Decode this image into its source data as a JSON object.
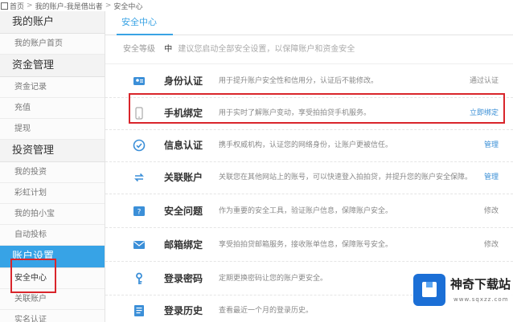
{
  "breadcrumb": {
    "items": [
      "首页",
      "我的账户-我是借出者",
      "安全中心"
    ]
  },
  "sidebar": {
    "groups": [
      {
        "label": "我的账户",
        "items": [
          "我的账户首页"
        ]
      },
      {
        "label": "资金管理",
        "items": [
          "资金记录",
          "充值",
          "提现"
        ]
      },
      {
        "label": "投资管理",
        "items": [
          "我的投资",
          "彩虹计划",
          "我的拍小宝",
          "自动投标"
        ]
      },
      {
        "label": "账户设置",
        "items": [
          "安全中心",
          "关联账户",
          "实名认证"
        ]
      }
    ],
    "active_group": "账户设置",
    "current_item": "安全中心"
  },
  "main": {
    "tab": "安全中心",
    "notice_label": "安全等级",
    "notice_level": "中",
    "notice_desc": "建议您启动全部安全设置，以保障账户和资金安全",
    "rows": [
      {
        "name": "身份认证",
        "desc": "用于提升账户安全性和信用分，认证后不能修改。",
        "action": "通过认证",
        "icon": "id-card-icon"
      },
      {
        "name": "手机绑定",
        "desc": "用于实时了解账户变动，享受拍拍贷手机服务。",
        "action": "立即绑定",
        "icon": "phone-icon"
      },
      {
        "name": "信息认证",
        "desc": "携手权威机构，认证您的网络身份，让账户更被信任。",
        "action": "管理",
        "icon": "check-circle-icon"
      },
      {
        "name": "关联账户",
        "desc": "关联您在其他网站上的账号，可以快速登入拍拍贷，并提升您的账户安全保障。",
        "action": "管理",
        "icon": "link-arrows-icon"
      },
      {
        "name": "安全问题",
        "desc": "作为重要的安全工具，验证账户信息，保障账户安全。",
        "action": "修改",
        "icon": "question-icon"
      },
      {
        "name": "邮箱绑定",
        "desc": "享受拍拍贷邮箱服务，接收账单信息，保障账号安全。",
        "action": "修改",
        "icon": "mail-icon"
      },
      {
        "name": "登录密码",
        "desc": "定期更换密码让您的账户更安全。",
        "action": "",
        "icon": "key-icon"
      },
      {
        "name": "登录历史",
        "desc": "查看最近一个月的登录历史。",
        "action": "",
        "icon": "history-icon"
      }
    ]
  },
  "watermark": {
    "title": "神奇下载站",
    "url": "www.sqxzz.com"
  },
  "colors": {
    "accent": "#37a3e6",
    "highlight": "#d9252b"
  }
}
